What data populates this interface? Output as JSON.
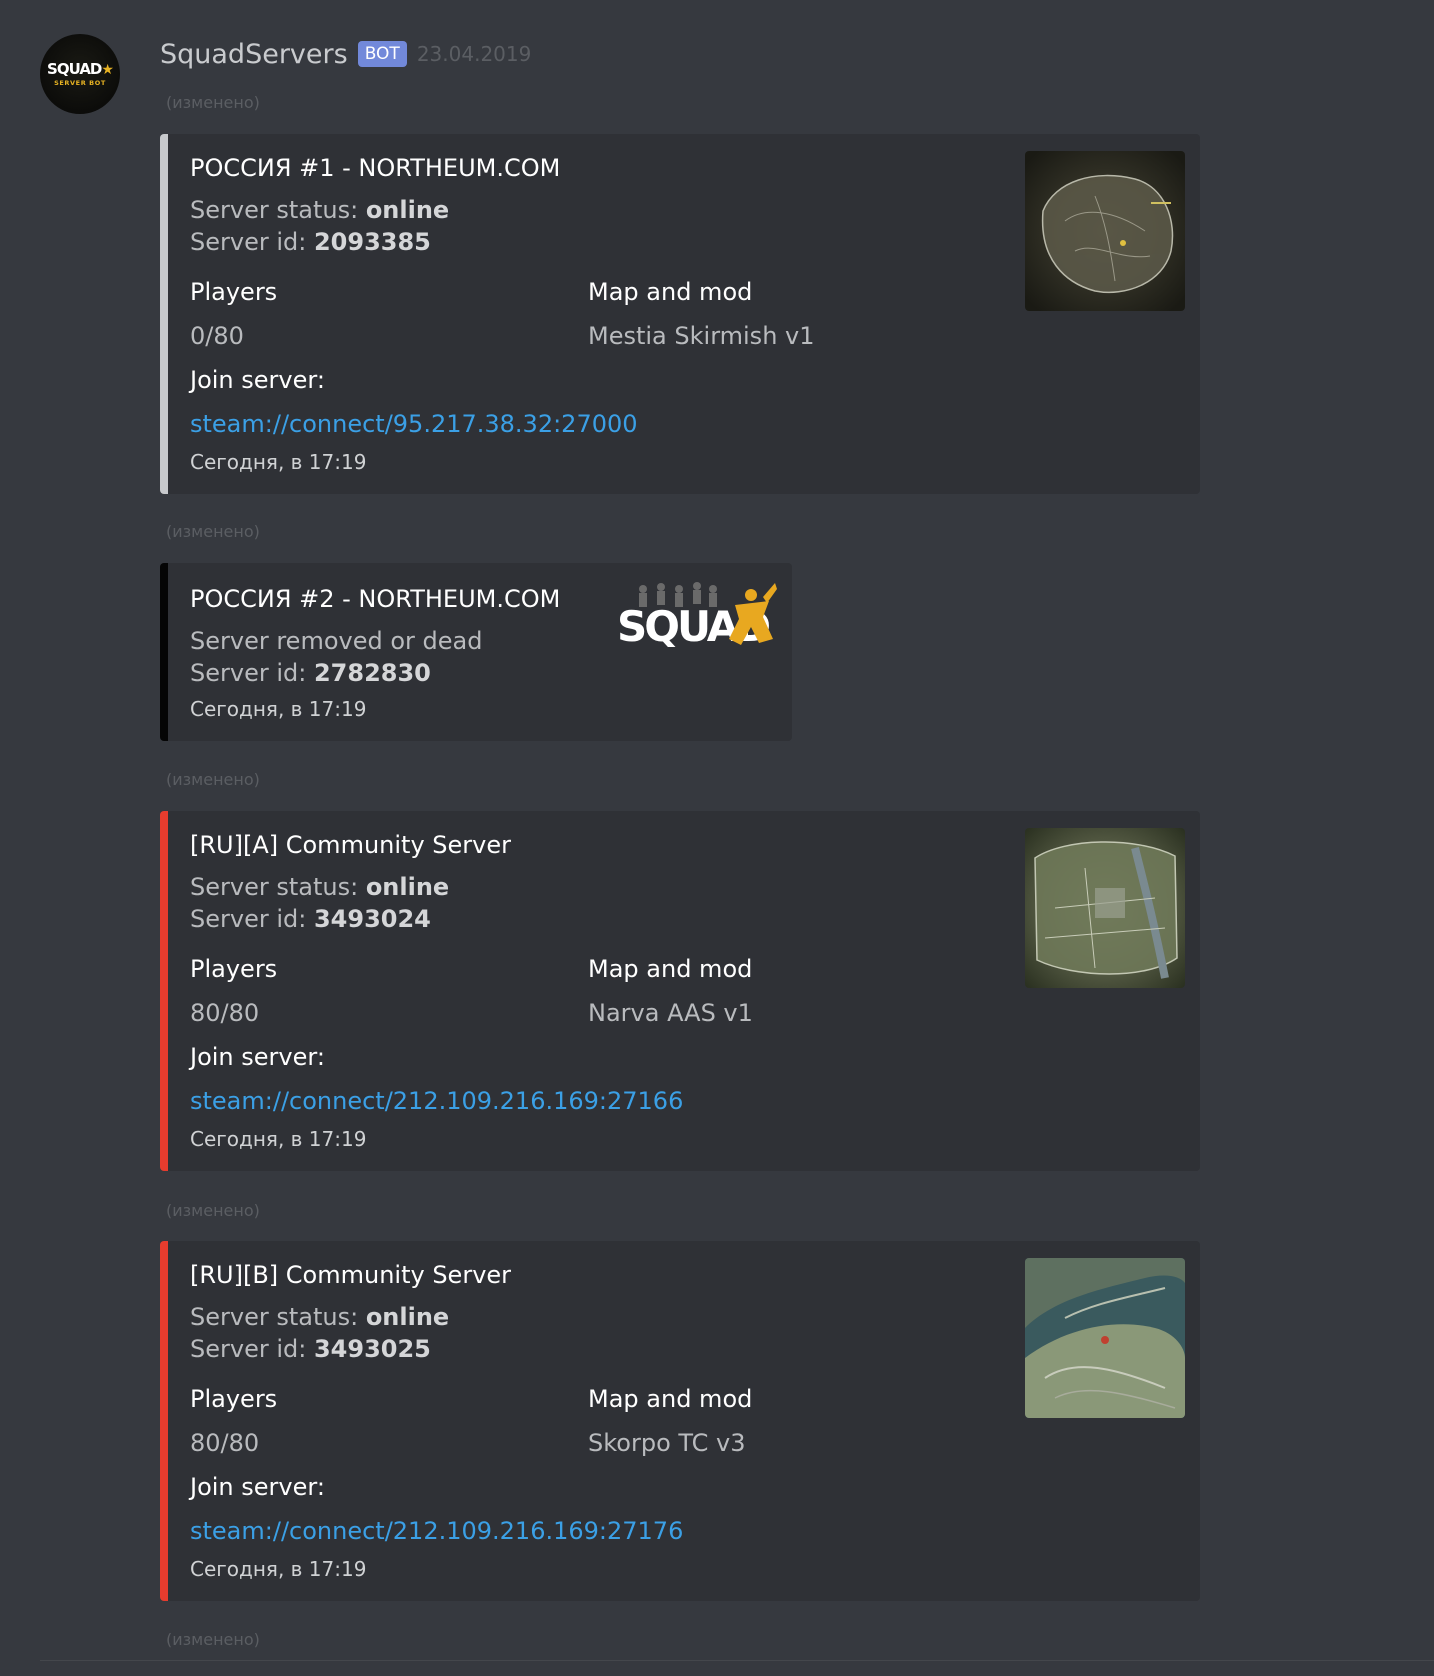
{
  "message": {
    "author": "SquadServers",
    "bot_tag": "BOT",
    "date": "23.04.2019",
    "avatar_text": "SQUAD",
    "avatar_subtext": "SERVER BOT",
    "edited_label": "(изменено)"
  },
  "colors": {
    "background": "#36393f",
    "embed_background": "#2f3136",
    "accent_grey": "#c7c9cc",
    "accent_black": "#050505",
    "accent_red": "#e63c2e",
    "link": "#3ba0e6",
    "bot_tag": "#7289da"
  },
  "embeds": [
    {
      "title": "РОССИЯ #1 - NORTHEUM.COM",
      "status_label": "Server status:",
      "status_value": "online",
      "id_label": "Server id:",
      "id_value": "2093385",
      "players_label": "Players",
      "players_value": "0/80",
      "map_label": "Map and mod",
      "map_value": "Mestia Skirmish v1",
      "join_label": "Join server:",
      "join_link": "steam://connect/95.217.38.32:27000",
      "footer": "Сегодня, в 17:19",
      "thumbnail": "map-thumbnail-mestia"
    },
    {
      "title": "РОССИЯ #2 - NORTHEUM.COM",
      "removed_text": "Server removed or dead",
      "id_label": "Server id:",
      "id_value": "2782830",
      "footer": "Сегодня, в 17:19",
      "logo_text": "SQUAD"
    },
    {
      "title": "[RU][A] Community Server",
      "status_label": "Server status:",
      "status_value": "online",
      "id_label": "Server id:",
      "id_value": "3493024",
      "players_label": "Players",
      "players_value": "80/80",
      "map_label": "Map and mod",
      "map_value": "Narva AAS v1",
      "join_label": "Join server:",
      "join_link": "steam://connect/212.109.216.169:27166",
      "footer": "Сегодня, в 17:19",
      "thumbnail": "map-thumbnail-narva"
    },
    {
      "title": "[RU][B] Community Server",
      "status_label": "Server status:",
      "status_value": "online",
      "id_label": "Server id:",
      "id_value": "3493025",
      "players_label": "Players",
      "players_value": "80/80",
      "map_label": "Map and mod",
      "map_value": "Skorpo TC v3",
      "join_label": "Join server:",
      "join_link": "steam://connect/212.109.216.169:27176",
      "footer": "Сегодня, в 17:19",
      "thumbnail": "map-thumbnail-skorpo"
    }
  ]
}
